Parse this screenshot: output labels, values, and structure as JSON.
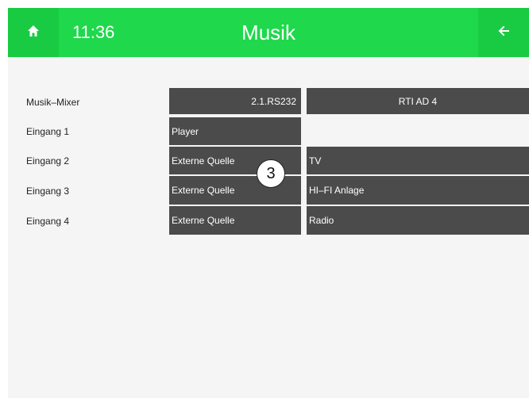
{
  "header": {
    "time": "11:36",
    "title": "Musik",
    "home_icon": "home-icon",
    "back_icon": "arrow-left-icon",
    "color": "#1fd84c"
  },
  "table": {
    "header_label": "Musik–Mixer",
    "col1_header": "2.1.RS232",
    "col2_header": "RTI AD 4",
    "rows": [
      {
        "label": "Eingang 1",
        "col1": "Player",
        "col2": ""
      },
      {
        "label": "Eingang 2",
        "col1": "Externe Quelle",
        "col2": "TV"
      },
      {
        "label": "Eingang 3",
        "col1": "Externe Quelle",
        "col2": "HI–FI Anlage"
      },
      {
        "label": "Eingang 4",
        "col1": "Externe Quelle",
        "col2": "Radio"
      }
    ]
  },
  "badge": "3"
}
